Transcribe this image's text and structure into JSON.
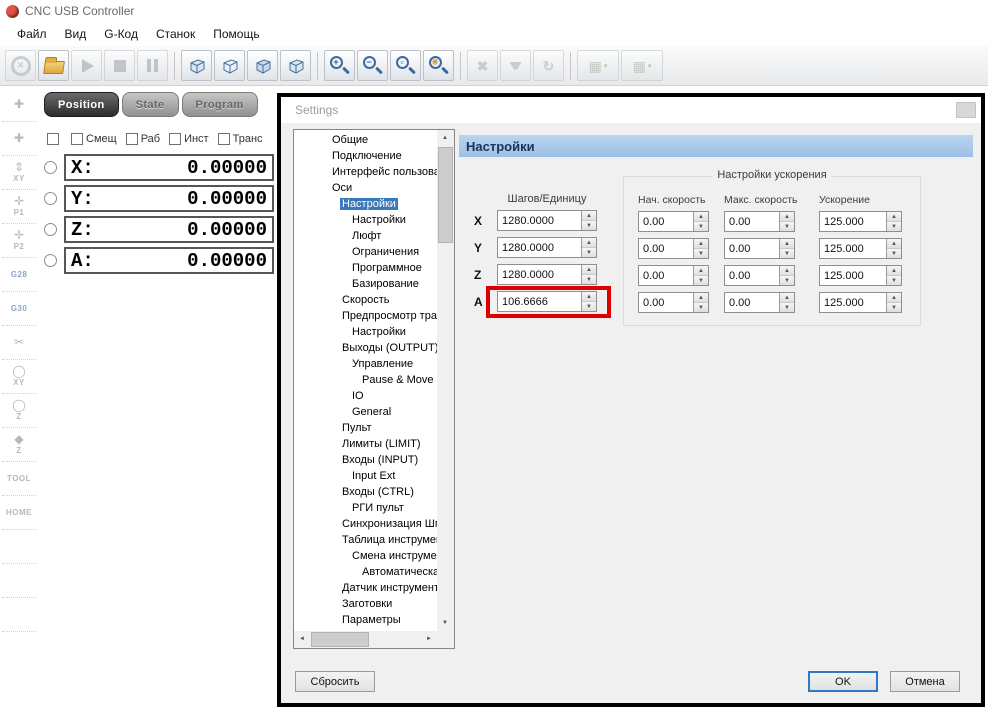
{
  "window": {
    "title": "CNC USB Controller"
  },
  "menu": {
    "items": [
      {
        "label": "Файл"
      },
      {
        "label": "Вид"
      },
      {
        "label": "G-Код"
      },
      {
        "label": "Станок"
      },
      {
        "label": "Помощь"
      }
    ]
  },
  "toolbar": {
    "glyphs": {
      "emergency": "✕",
      "zoom_in": "+",
      "zoom_out": "−",
      "zoom_window": "▫",
      "zoom_fit": "✳",
      "tool_cross": "✖",
      "rotate": "↻",
      "grid": "▦",
      "dropdown": "▾"
    }
  },
  "left_rail": {
    "items": [
      {
        "glyph": "✚",
        "label": ""
      },
      {
        "glyph": "✚",
        "label": ""
      },
      {
        "glyph": "⇕",
        "label": "XY"
      },
      {
        "glyph": "✛",
        "label": "P1"
      },
      {
        "glyph": "✛",
        "label": "P2"
      },
      {
        "glyph": "",
        "label": "G28",
        "accent": true
      },
      {
        "glyph": "",
        "label": "G30",
        "accent": true
      },
      {
        "glyph": "✂",
        "label": ""
      },
      {
        "glyph": "◯",
        "label": "XY"
      },
      {
        "glyph": "◯",
        "label": "Z"
      },
      {
        "glyph": "◆",
        "label": "Z"
      },
      {
        "glyph": "",
        "label": "TOOL"
      },
      {
        "glyph": "",
        "label": "HOME"
      },
      {
        "glyph": "",
        "label": ""
      },
      {
        "glyph": "",
        "label": ""
      },
      {
        "glyph": "",
        "label": ""
      }
    ]
  },
  "position_panel": {
    "tabs": [
      {
        "label": "Position",
        "active": true
      },
      {
        "label": "State",
        "active": false
      },
      {
        "label": "Program",
        "active": false
      }
    ],
    "checkboxes": [
      {
        "label": ""
      },
      {
        "label": "Смещ"
      },
      {
        "label": "Раб"
      },
      {
        "label": "Инст"
      },
      {
        "label": "Транс"
      }
    ],
    "axes": [
      {
        "label": "X:",
        "value": "0.00000"
      },
      {
        "label": "Y:",
        "value": "0.00000"
      },
      {
        "label": "Z:",
        "value": "0.00000"
      },
      {
        "label": "A:",
        "value": "0.00000"
      }
    ]
  },
  "dialog": {
    "title": "Settings",
    "header": "Настройки",
    "selection_color": "#3b78bc",
    "highlight_color": "#dd0000",
    "tree": {
      "items": [
        {
          "label": "Общие",
          "level": 0
        },
        {
          "label": "Подключение",
          "level": 0
        },
        {
          "label": "Интерфейс пользовате",
          "level": 0
        },
        {
          "label": "Оси",
          "level": 0
        },
        {
          "label": "Настройки",
          "level": 1,
          "selected": true
        },
        {
          "label": "Настройки",
          "level": 2
        },
        {
          "label": "Люфт",
          "level": 2
        },
        {
          "label": "Ограничения",
          "level": 2
        },
        {
          "label": "Программное",
          "level": 2
        },
        {
          "label": "Базирование",
          "level": 2
        },
        {
          "label": "Скорость",
          "level": 1
        },
        {
          "label": "Предпросмотр траекто",
          "level": 1
        },
        {
          "label": "Настройки",
          "level": 2
        },
        {
          "label": "Выходы (OUTPUT)",
          "level": 1
        },
        {
          "label": "Управление",
          "level": 2
        },
        {
          "label": "Pause & Move",
          "level": 3
        },
        {
          "label": "IO",
          "level": 2
        },
        {
          "label": "General",
          "level": 2
        },
        {
          "label": "Пульт",
          "level": 1
        },
        {
          "label": "Лимиты (LIMIT)",
          "level": 1
        },
        {
          "label": "Входы (INPUT)",
          "level": 1
        },
        {
          "label": "Input Ext",
          "level": 2
        },
        {
          "label": "Входы (CTRL)",
          "level": 1
        },
        {
          "label": "РГИ пульт",
          "level": 2
        },
        {
          "label": "Синхронизация Шпинде",
          "level": 1
        },
        {
          "label": "Таблица инструментов",
          "level": 1
        },
        {
          "label": "Смена инструмента",
          "level": 2
        },
        {
          "label": "Автоматическая см",
          "level": 3
        },
        {
          "label": "Датчик инструмента",
          "level": 1
        },
        {
          "label": "Заготовки",
          "level": 1
        },
        {
          "label": "Параметры",
          "level": 1
        }
      ]
    },
    "steps": {
      "header": "Шагов/Единицу",
      "rows": [
        {
          "axis": "X",
          "value": "1280.0000",
          "highlighted": false
        },
        {
          "axis": "Y",
          "value": "1280.0000",
          "highlighted": false
        },
        {
          "axis": "Z",
          "value": "1280.0000",
          "highlighted": false
        },
        {
          "axis": "A",
          "value": "106.6666",
          "highlighted": true
        }
      ]
    },
    "accel": {
      "title": "Настройки ускорения",
      "columns": [
        {
          "label": "Нач. скорость"
        },
        {
          "label": "Макс. скорость"
        },
        {
          "label": "Ускорение"
        }
      ],
      "rows": [
        {
          "start": "0.00",
          "max": "0.00",
          "accel": "125.000"
        },
        {
          "start": "0.00",
          "max": "0.00",
          "accel": "125.000"
        },
        {
          "start": "0.00",
          "max": "0.00",
          "accel": "125.000"
        },
        {
          "start": "0.00",
          "max": "0.00",
          "accel": "125.000"
        }
      ]
    },
    "buttons": {
      "reset": "Сбросить",
      "ok": "OK",
      "cancel": "Отмена"
    }
  }
}
